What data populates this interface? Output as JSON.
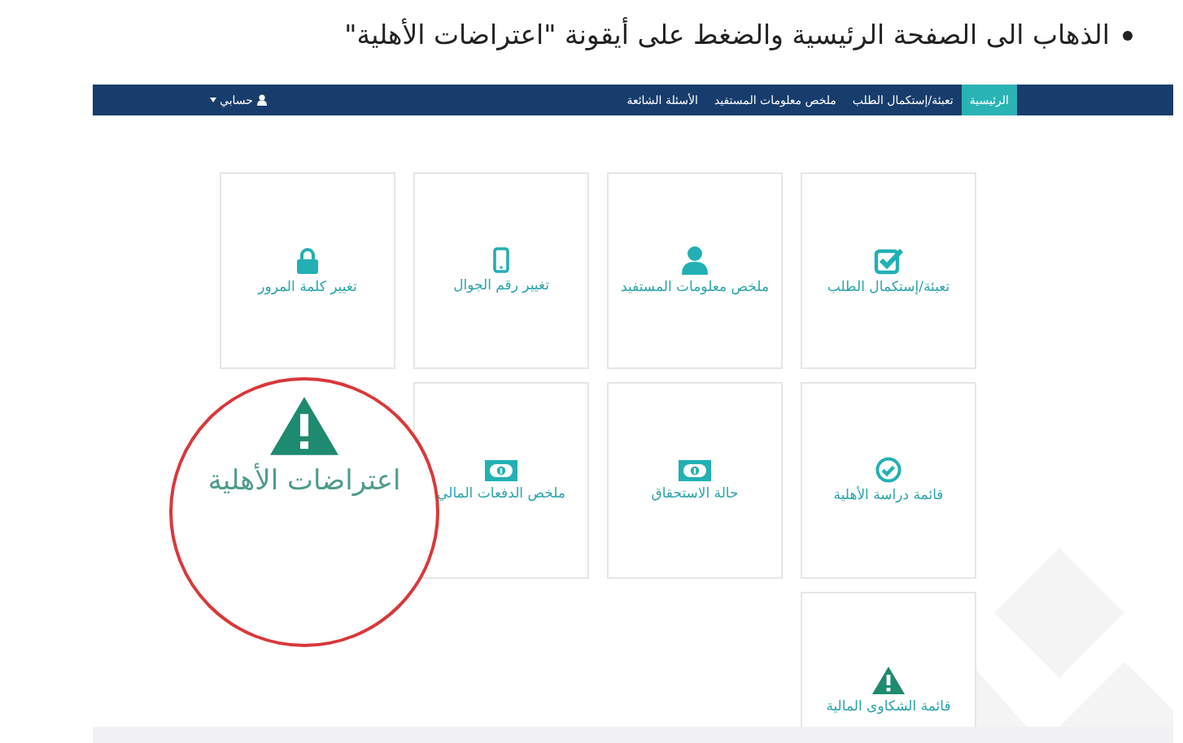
{
  "instruction": "الذهاب الى الصفحة الرئيسية والضغط على أيقونة \"اعتراضات الأهلية\"",
  "navbar": {
    "items": [
      {
        "label": "الرئيسية",
        "selected": true
      },
      {
        "label": "تعبئة/إستكمال الطلب",
        "selected": false
      },
      {
        "label": "ملخص معلومات المستفيد",
        "selected": false
      },
      {
        "label": "الأسئلة الشائعة",
        "selected": false
      }
    ],
    "account": "حسابي"
  },
  "tiles": [
    {
      "label": "تعبئة/إستكمال الطلب",
      "kind": "checkbox"
    },
    {
      "label": "ملخص معلومات المستفيد",
      "kind": "user"
    },
    {
      "label": "تغيير رقم الجوال",
      "kind": "mobile"
    },
    {
      "label": "تغيير كلمة المرور",
      "kind": "lock"
    },
    {
      "label": "قائمة دراسة الأهلية",
      "kind": "check"
    },
    {
      "label": "حالة الاستحقاق",
      "kind": "money"
    },
    {
      "label": "ملخص الدفعات المالي",
      "kind": "money"
    },
    {
      "label": "اعتراضات الأهلية",
      "kind": "warning",
      "highlighted": true
    },
    {
      "label": "قائمة الشكاوى المالية",
      "kind": "warning",
      "highlighted": false
    }
  ]
}
